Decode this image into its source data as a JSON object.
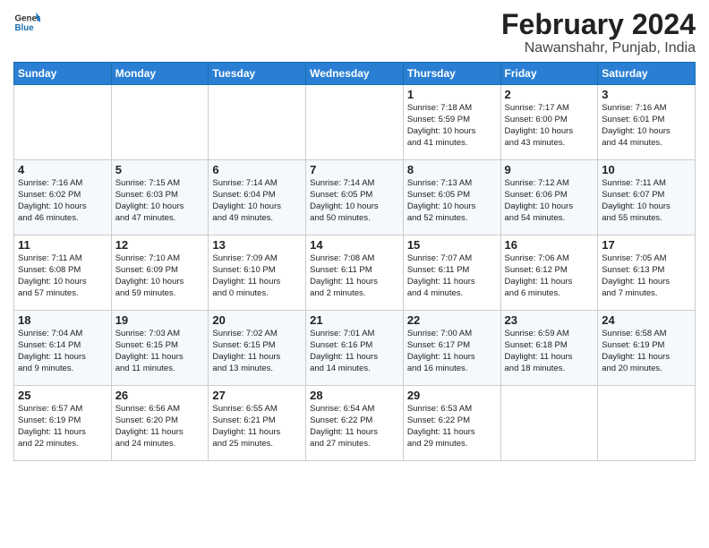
{
  "header": {
    "logo_line1": "General",
    "logo_line2": "Blue",
    "month_year": "February 2024",
    "location": "Nawanshahr, Punjab, India"
  },
  "weekdays": [
    "Sunday",
    "Monday",
    "Tuesday",
    "Wednesday",
    "Thursday",
    "Friday",
    "Saturday"
  ],
  "weeks": [
    [
      {
        "day": "",
        "info": ""
      },
      {
        "day": "",
        "info": ""
      },
      {
        "day": "",
        "info": ""
      },
      {
        "day": "",
        "info": ""
      },
      {
        "day": "1",
        "info": "Sunrise: 7:18 AM\nSunset: 5:59 PM\nDaylight: 10 hours\nand 41 minutes."
      },
      {
        "day": "2",
        "info": "Sunrise: 7:17 AM\nSunset: 6:00 PM\nDaylight: 10 hours\nand 43 minutes."
      },
      {
        "day": "3",
        "info": "Sunrise: 7:16 AM\nSunset: 6:01 PM\nDaylight: 10 hours\nand 44 minutes."
      }
    ],
    [
      {
        "day": "4",
        "info": "Sunrise: 7:16 AM\nSunset: 6:02 PM\nDaylight: 10 hours\nand 46 minutes."
      },
      {
        "day": "5",
        "info": "Sunrise: 7:15 AM\nSunset: 6:03 PM\nDaylight: 10 hours\nand 47 minutes."
      },
      {
        "day": "6",
        "info": "Sunrise: 7:14 AM\nSunset: 6:04 PM\nDaylight: 10 hours\nand 49 minutes."
      },
      {
        "day": "7",
        "info": "Sunrise: 7:14 AM\nSunset: 6:05 PM\nDaylight: 10 hours\nand 50 minutes."
      },
      {
        "day": "8",
        "info": "Sunrise: 7:13 AM\nSunset: 6:05 PM\nDaylight: 10 hours\nand 52 minutes."
      },
      {
        "day": "9",
        "info": "Sunrise: 7:12 AM\nSunset: 6:06 PM\nDaylight: 10 hours\nand 54 minutes."
      },
      {
        "day": "10",
        "info": "Sunrise: 7:11 AM\nSunset: 6:07 PM\nDaylight: 10 hours\nand 55 minutes."
      }
    ],
    [
      {
        "day": "11",
        "info": "Sunrise: 7:11 AM\nSunset: 6:08 PM\nDaylight: 10 hours\nand 57 minutes."
      },
      {
        "day": "12",
        "info": "Sunrise: 7:10 AM\nSunset: 6:09 PM\nDaylight: 10 hours\nand 59 minutes."
      },
      {
        "day": "13",
        "info": "Sunrise: 7:09 AM\nSunset: 6:10 PM\nDaylight: 11 hours\nand 0 minutes."
      },
      {
        "day": "14",
        "info": "Sunrise: 7:08 AM\nSunset: 6:11 PM\nDaylight: 11 hours\nand 2 minutes."
      },
      {
        "day": "15",
        "info": "Sunrise: 7:07 AM\nSunset: 6:11 PM\nDaylight: 11 hours\nand 4 minutes."
      },
      {
        "day": "16",
        "info": "Sunrise: 7:06 AM\nSunset: 6:12 PM\nDaylight: 11 hours\nand 6 minutes."
      },
      {
        "day": "17",
        "info": "Sunrise: 7:05 AM\nSunset: 6:13 PM\nDaylight: 11 hours\nand 7 minutes."
      }
    ],
    [
      {
        "day": "18",
        "info": "Sunrise: 7:04 AM\nSunset: 6:14 PM\nDaylight: 11 hours\nand 9 minutes."
      },
      {
        "day": "19",
        "info": "Sunrise: 7:03 AM\nSunset: 6:15 PM\nDaylight: 11 hours\nand 11 minutes."
      },
      {
        "day": "20",
        "info": "Sunrise: 7:02 AM\nSunset: 6:15 PM\nDaylight: 11 hours\nand 13 minutes."
      },
      {
        "day": "21",
        "info": "Sunrise: 7:01 AM\nSunset: 6:16 PM\nDaylight: 11 hours\nand 14 minutes."
      },
      {
        "day": "22",
        "info": "Sunrise: 7:00 AM\nSunset: 6:17 PM\nDaylight: 11 hours\nand 16 minutes."
      },
      {
        "day": "23",
        "info": "Sunrise: 6:59 AM\nSunset: 6:18 PM\nDaylight: 11 hours\nand 18 minutes."
      },
      {
        "day": "24",
        "info": "Sunrise: 6:58 AM\nSunset: 6:19 PM\nDaylight: 11 hours\nand 20 minutes."
      }
    ],
    [
      {
        "day": "25",
        "info": "Sunrise: 6:57 AM\nSunset: 6:19 PM\nDaylight: 11 hours\nand 22 minutes."
      },
      {
        "day": "26",
        "info": "Sunrise: 6:56 AM\nSunset: 6:20 PM\nDaylight: 11 hours\nand 24 minutes."
      },
      {
        "day": "27",
        "info": "Sunrise: 6:55 AM\nSunset: 6:21 PM\nDaylight: 11 hours\nand 25 minutes."
      },
      {
        "day": "28",
        "info": "Sunrise: 6:54 AM\nSunset: 6:22 PM\nDaylight: 11 hours\nand 27 minutes."
      },
      {
        "day": "29",
        "info": "Sunrise: 6:53 AM\nSunset: 6:22 PM\nDaylight: 11 hours\nand 29 minutes."
      },
      {
        "day": "",
        "info": ""
      },
      {
        "day": "",
        "info": ""
      }
    ]
  ]
}
